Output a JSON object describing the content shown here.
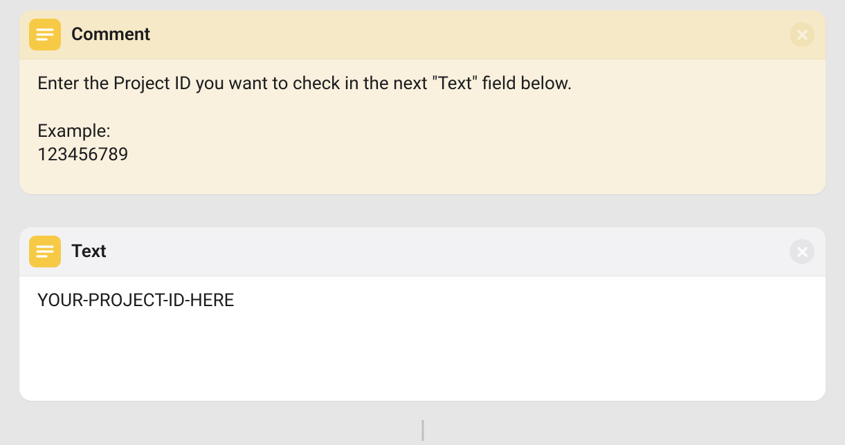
{
  "actions": {
    "comment": {
      "title": "Comment",
      "body": "Enter the Project ID you want to check in the next \"Text\" field below.\n\nExample:\n123456789"
    },
    "text": {
      "title": "Text",
      "body": "YOUR-PROJECT-ID-HERE"
    }
  }
}
